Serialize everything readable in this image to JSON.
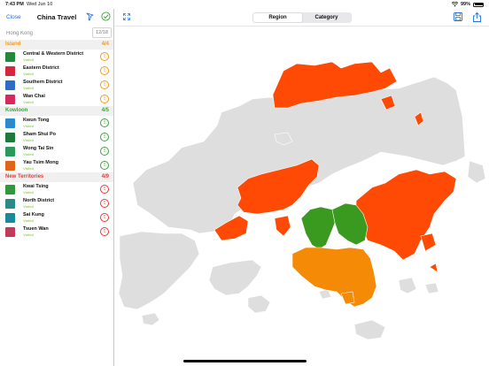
{
  "status_bar": {
    "time": "7:43 PM",
    "date": "Wed Jun 10",
    "battery": "99%"
  },
  "nav": {
    "close_label": "Close",
    "title": "China Travel"
  },
  "search": {
    "value": "Hong Kong",
    "counter": "12/18"
  },
  "sections": [
    {
      "name": "Island",
      "count": "4/4",
      "items": [
        {
          "title": "Central & Western District",
          "sub": "Visited",
          "thumb_color": "#1e8a3a",
          "status": "warning"
        },
        {
          "title": "Eastern District",
          "sub": "Visited",
          "thumb_color": "#d6263b",
          "status": "warning"
        },
        {
          "title": "Southern District",
          "sub": "Visited",
          "thumb_color": "#2a6cc8",
          "status": "warning"
        },
        {
          "title": "Wan Chai",
          "sub": "Visited",
          "thumb_color": "#d62a5e",
          "status": "warning"
        }
      ]
    },
    {
      "name": "Kowloon",
      "count": "4/5",
      "items": [
        {
          "title": "Kwun Tong",
          "sub": "Visited",
          "thumb_color": "#2a8ad0",
          "status": "ok"
        },
        {
          "title": "Sham Shui Po",
          "sub": "Visited",
          "thumb_color": "#1e7a3a",
          "status": "ok"
        },
        {
          "title": "Wong Tai Sin",
          "sub": "Visited",
          "thumb_color": "#2a9a5a",
          "status": "ok"
        },
        {
          "title": "Yau Tsim Mong",
          "sub": "Visited",
          "thumb_color": "#e0651a",
          "status": "ok"
        }
      ]
    },
    {
      "name": "New Territories",
      "count": "4/9",
      "items": [
        {
          "title": "Kwai Tsing",
          "sub": "Visited",
          "thumb_color": "#2f9a3a",
          "status": "error"
        },
        {
          "title": "North District",
          "sub": "Visited",
          "thumb_color": "#2a8a8a",
          "status": "error"
        },
        {
          "title": "Sai Kung",
          "sub": "Visited",
          "thumb_color": "#1a8a9a",
          "status": "error"
        },
        {
          "title": "Tsuen Wan",
          "sub": "Visited",
          "thumb_color": "#c23a5a",
          "status": "error"
        }
      ]
    }
  ],
  "colors": {
    "island_orange": "#f58a07",
    "kowloon_green": "#3a9a1f",
    "nt_red": "#fe4a05",
    "grey_land": "#dedede",
    "warning": "#f39a1c",
    "ok": "#3aa43a",
    "error": "#e53935",
    "accent": "#2b6fd6"
  },
  "main": {
    "segments": [
      "Region",
      "Category"
    ],
    "selected_segment": "Region"
  }
}
